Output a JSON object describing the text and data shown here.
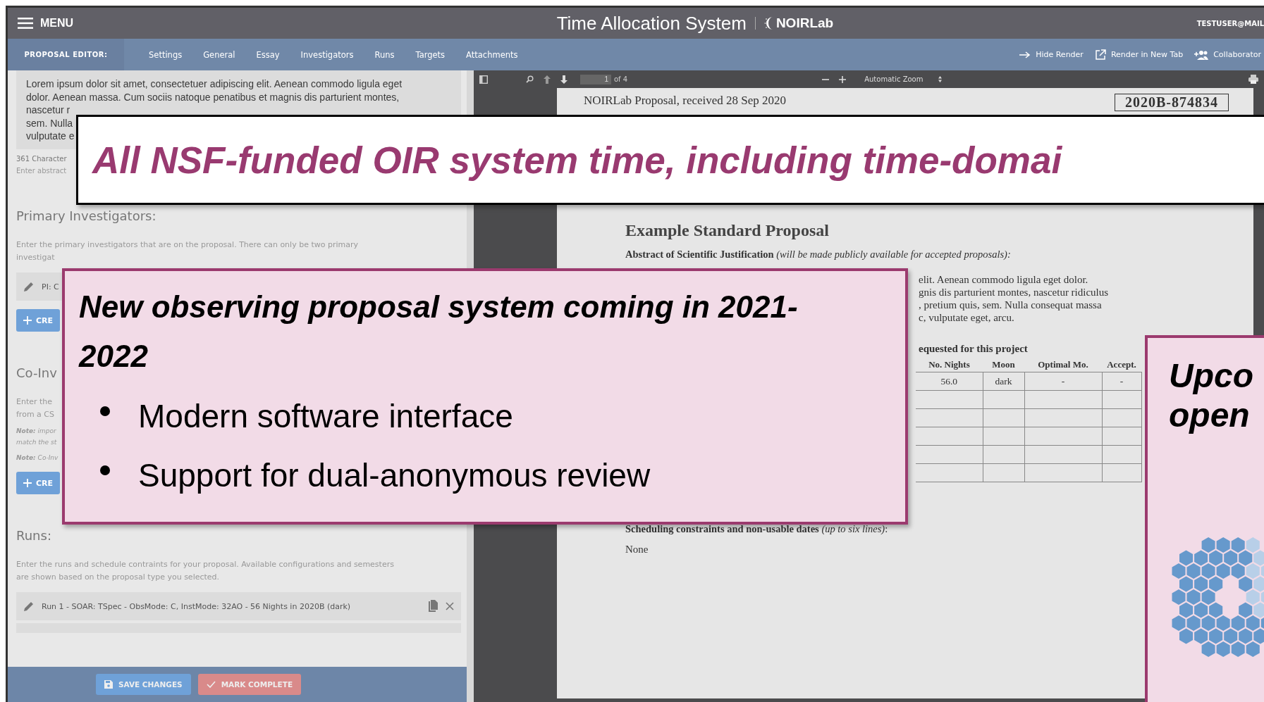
{
  "header": {
    "menu": "MENU",
    "title": "Time Allocation System",
    "logo": "NOIRLab",
    "user": "TESTUSER@MAIL"
  },
  "editor_bar": {
    "label": "PROPOSAL EDITOR:",
    "tabs": [
      {
        "label": "Settings",
        "selected": false
      },
      {
        "label": "General",
        "selected": false
      },
      {
        "label": "Essay",
        "selected": false
      },
      {
        "label": "Investigators",
        "selected": false
      },
      {
        "label": "Runs",
        "selected": false
      },
      {
        "label": "Targets",
        "selected": false
      },
      {
        "label": "Attachments",
        "selected": false
      }
    ],
    "actions": [
      {
        "kind": "hide",
        "label": "Hide Render"
      },
      {
        "kind": "new_tab",
        "label": "Render in New Tab"
      },
      {
        "kind": "collaborators",
        "label": "Collaborator"
      }
    ]
  },
  "form": {
    "abstract": {
      "lines": [
        "Lorem ipsum dolor sit amet, consectetuer adipiscing elit. Aenean commodo ligula eget",
        "dolor. Aenean massa. Cum sociis natoque penatibus et magnis dis parturient montes,",
        "nascetur r",
        "sem. Nulla",
        "vulputate e"
      ],
      "count": "361 Character",
      "hint": "Enter abstract"
    },
    "blocks": [
      {
        "kind": "heading",
        "text": "Primary Investigators:"
      },
      {
        "kind": "hint",
        "lines": [
          "Enter the primary investigators that are on the proposal. There can only be two primary",
          "investigat"
        ]
      },
      {
        "kind": "item",
        "text": "PI: C"
      },
      {
        "kind": "create",
        "label": "CRE"
      },
      {
        "kind": "heading",
        "text": "Co-Inv"
      },
      {
        "kind": "hint",
        "lines": [
          "Enter the",
          "from a CS"
        ]
      },
      {
        "kind": "note",
        "lines": [
          "**Note:** impor",
          "match the st"
        ]
      },
      {
        "kind": "note",
        "lines": [
          "**Note:** Co-Inv"
        ]
      },
      {
        "kind": "create",
        "label": "CRE"
      },
      {
        "kind": "heading",
        "text": "Runs:"
      },
      {
        "kind": "hint",
        "lines": [
          "Enter the runs and schedule contraints for your proposal. Available configurations and semesters",
          "are shown based on the proposal type you selected."
        ]
      },
      {
        "kind": "run",
        "text": "Run 1 - SOAR: TSpec - ObsMode: C, InstMode: 32AO  - 56 Nights in 2020B (dark)"
      },
      {
        "kind": "run_hidden"
      }
    ],
    "buttons": [
      {
        "kind": "save",
        "label": "SAVE CHANGES"
      },
      {
        "kind": "complete",
        "label": "MARK COMPLETE"
      }
    ]
  },
  "viewer": {
    "page_number": "1",
    "page_count": "of 4",
    "zoom": "Automatic Zoom",
    "page": {
      "received": "NOIRLab Proposal, received 28 Sep 2020",
      "id": "2020B-874834",
      "title": "Example Standard Proposal",
      "abstract_heading": "**Abstract of Scientific Justification** *(will be made publicly available for accepted proposals):*",
      "abstract_lines": [
        "elit. Aenean commodo ligula eget dolor.",
        "gnis dis parturient montes, nascetur ridiculus",
        ", pretium quis, sem. Nulla consequat massa",
        "c, vulputate eget, arcu."
      ],
      "table_caption": "equested for this project",
      "table": {
        "columns": [
          "No. Nights",
          "Moon",
          "Optimal Mo.",
          "Accept."
        ],
        "rows": [
          {
            "kind": "filled",
            "cells": [
              "56.0",
              "dark",
              "-",
              "-"
            ]
          },
          {
            "kind": "blank"
          },
          {
            "kind": "blank"
          },
          {
            "kind": "blank"
          },
          {
            "kind": "blank"
          },
          {
            "kind": "blank"
          }
        ]
      },
      "constraints_heading": "**Scheduling constraints and non-usable dates** *(up to six lines)*:",
      "constraints": "None"
    }
  },
  "callouts": [
    {
      "kind": "banner",
      "lines": [
        "All NSF-funded OIR system time, including time-domai"
      ]
    },
    {
      "kind": "panel",
      "title": "New observing proposal system coming in 2021-2022",
      "bullets": [
        "Modern software interface",
        "Support for dual-anonymous review"
      ]
    },
    {
      "kind": "side",
      "lines": [
        "Upco",
        "open"
      ]
    }
  ]
}
